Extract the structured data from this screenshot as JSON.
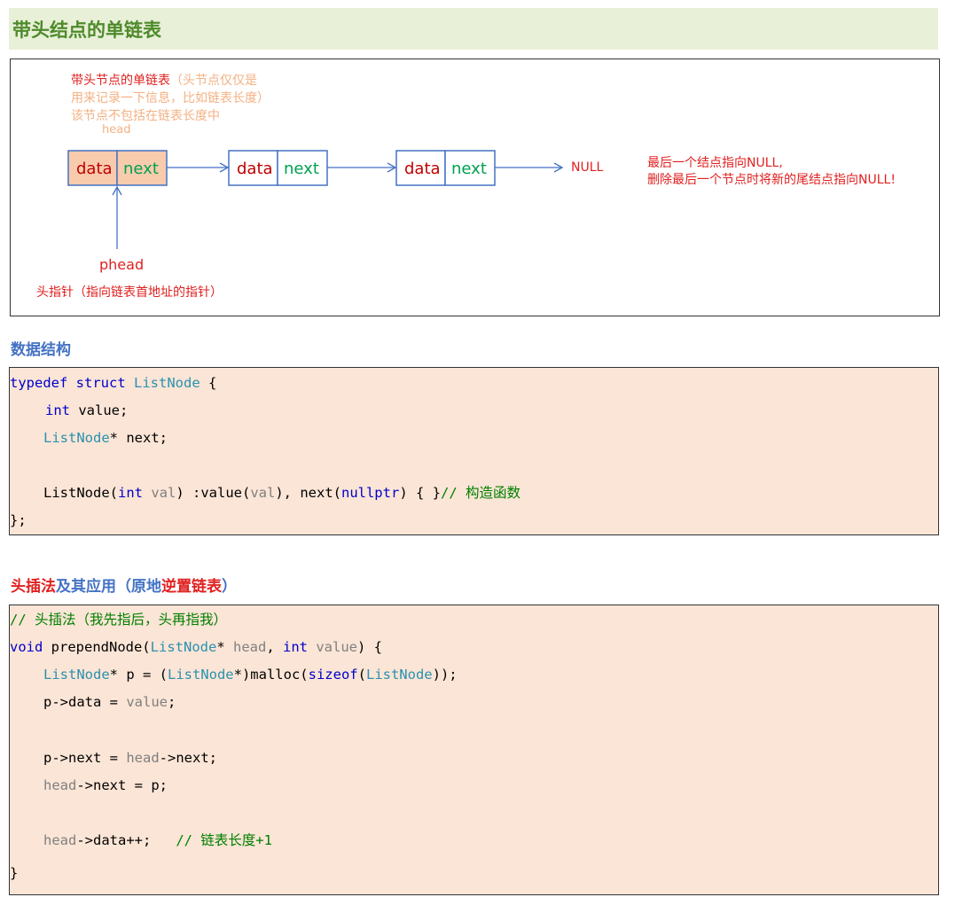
{
  "title": "带头结点的单链表",
  "diagram": {
    "head_desc": [
      "带头节点的单链表",
      "（头节点仅仅是",
      "用来记录一下信息，比如链表长度）",
      "该节点不包括在链表长度中"
    ],
    "head_label": "head",
    "node_data": "data",
    "node_next": "next",
    "null_label": "NULL",
    "tail_note_1": "最后一个结点指向NULL,",
    "tail_note_2": "删除最后一个节点时将新的尾结点指向NULL!",
    "phead_label": "phead",
    "phead_desc": "头指针（指向链表首地址的指针）"
  },
  "section1": {
    "title": "数据结构"
  },
  "section2": {
    "title_part1": "头插法",
    "title_part2": "及其应用（原地",
    "title_part3": "逆置链表",
    "title_part4": "）"
  },
  "code1": {
    "l1_a": "typedef",
    "l1_b": " struct",
    " l1_c": "",
    "l1_name": "ListNode",
    "l1_brace": " {",
    "l2_type": "int",
    "l2_rest": " value;",
    "l3_type": "ListNode",
    "l3_rest": "* next;",
    "l5_a": "ListNode(",
    "l5_int": "int",
    "l5_val": " val",
    "l5_b": ") :value(",
    "l5_val2": "val",
    "l5_c": "), next(",
    "l5_null": "nullptr",
    "l5_d": ") { }",
    "l5_cm": "// 构造函数",
    "l6": "};"
  },
  "code2": {
    "l1_cm": "// 头插法（我先指后，头再指我）",
    "l2_void": "void",
    "l2_fn": " prependNode(",
    "l2_ty": "ListNode",
    "l2_star": "*",
    "l2_head": " head",
    "l2_comma": ", ",
    "l2_int": "int",
    "l2_value": " value",
    "l2_end": ") {",
    "l3_ty": "ListNode",
    "l3_a": "* p = (",
    "l3_ty2": "ListNode",
    "l3_b": "*)malloc(",
    "l3_kw": "sizeof",
    "l3_c": "(",
    "l3_ty3": "ListNode",
    "l3_d": "));",
    "l4_a": "p->data = ",
    "l4_v": "value",
    "l4_b": ";",
    "l6_a": "p->next = ",
    "l6_h": "head",
    "l6_b": "->next;",
    "l7_h": "head",
    "l7_b": "->next = p;",
    "l9_h": "head",
    "l9_b": "->data++;   ",
    "l9_cm": "// 链表长度+1",
    "l11": "}"
  }
}
